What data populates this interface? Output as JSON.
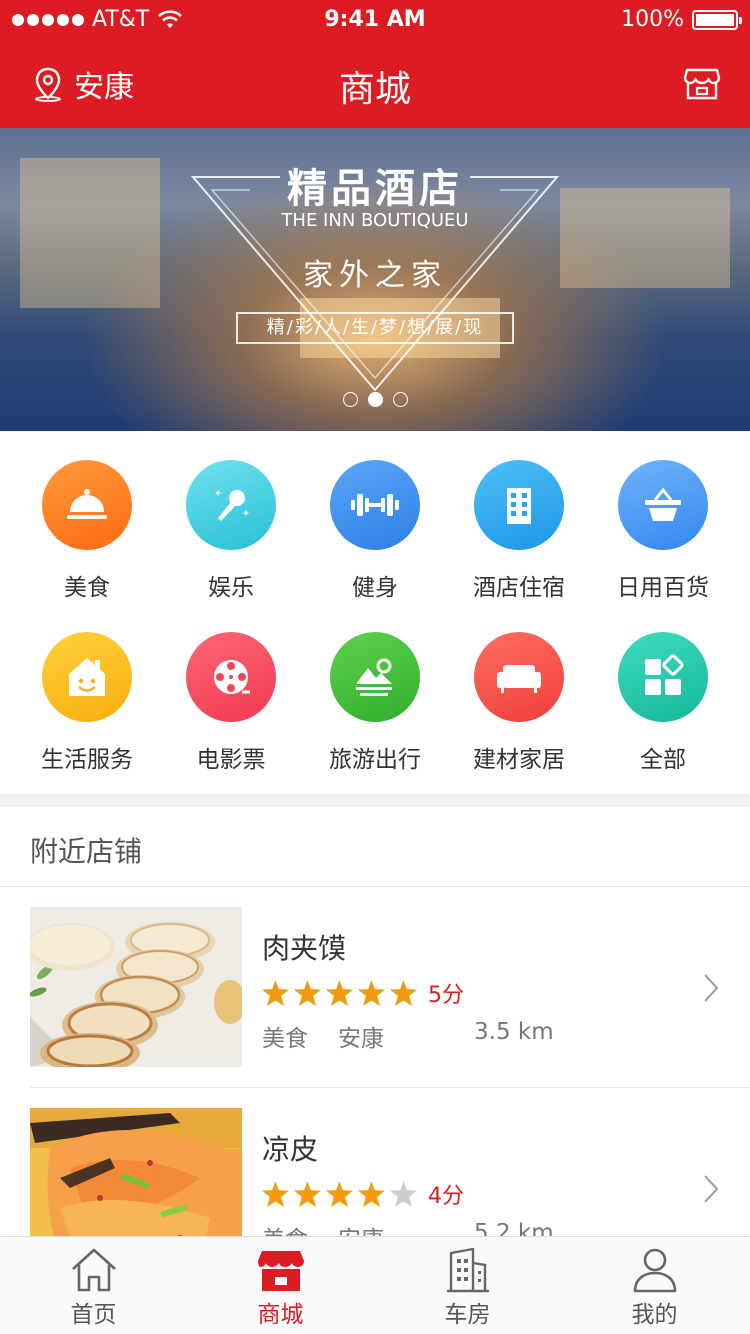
{
  "status_bar": {
    "carrier": "AT&T",
    "time": "9:41 AM",
    "battery": "100%"
  },
  "header": {
    "location": "安康",
    "title": "商城"
  },
  "banner": {
    "title": "精品酒店",
    "subtitle": "THE INN BOUTIQUEU",
    "tagline": "家外之家",
    "motto": "精/彩/人/生/梦/想/展/现",
    "page_index": 2,
    "page_count": 3
  },
  "categories": [
    {
      "label": "美食",
      "icon": "food-cloche-icon",
      "color": "#ff7a1e"
    },
    {
      "label": "娱乐",
      "icon": "microphone-icon",
      "color": "#3fcde0"
    },
    {
      "label": "健身",
      "icon": "dumbbell-icon",
      "color": "#3d8ff2"
    },
    {
      "label": "酒店住宿",
      "icon": "building-icon",
      "color": "#2eaaf0"
    },
    {
      "label": "日用百货",
      "icon": "basket-icon",
      "color": "#4a9cf5"
    },
    {
      "label": "生活服务",
      "icon": "smile-house-icon",
      "color": "#fbbd1c"
    },
    {
      "label": "电影票",
      "icon": "film-reel-icon",
      "color": "#f54a5d"
    },
    {
      "label": "旅游出行",
      "icon": "landscape-icon",
      "color": "#43c03d"
    },
    {
      "label": "建材家居",
      "icon": "sofa-icon",
      "color": "#f5564f"
    },
    {
      "label": "全部",
      "icon": "grid-icon",
      "color": "#22c8a8"
    }
  ],
  "nearby": {
    "title": "附近店铺",
    "shops": [
      {
        "name": "肉夹馍",
        "rating": 5,
        "score": "5分",
        "category": "美食",
        "area": "安康",
        "distance": "3.5 km"
      },
      {
        "name": "凉皮",
        "rating": 4,
        "score": "4分",
        "category": "美食",
        "area": "安康",
        "distance": "5.2 km"
      }
    ]
  },
  "tabbar": [
    {
      "label": "首页",
      "icon": "home-icon",
      "active": false
    },
    {
      "label": "商城",
      "icon": "store-icon",
      "active": true
    },
    {
      "label": "车房",
      "icon": "building-icon",
      "active": false
    },
    {
      "label": "我的",
      "icon": "person-icon",
      "active": false
    }
  ],
  "colors": {
    "brand_red": "#dd1b22",
    "star_orange": "#f59a0c",
    "star_gray": "#cccccc"
  }
}
